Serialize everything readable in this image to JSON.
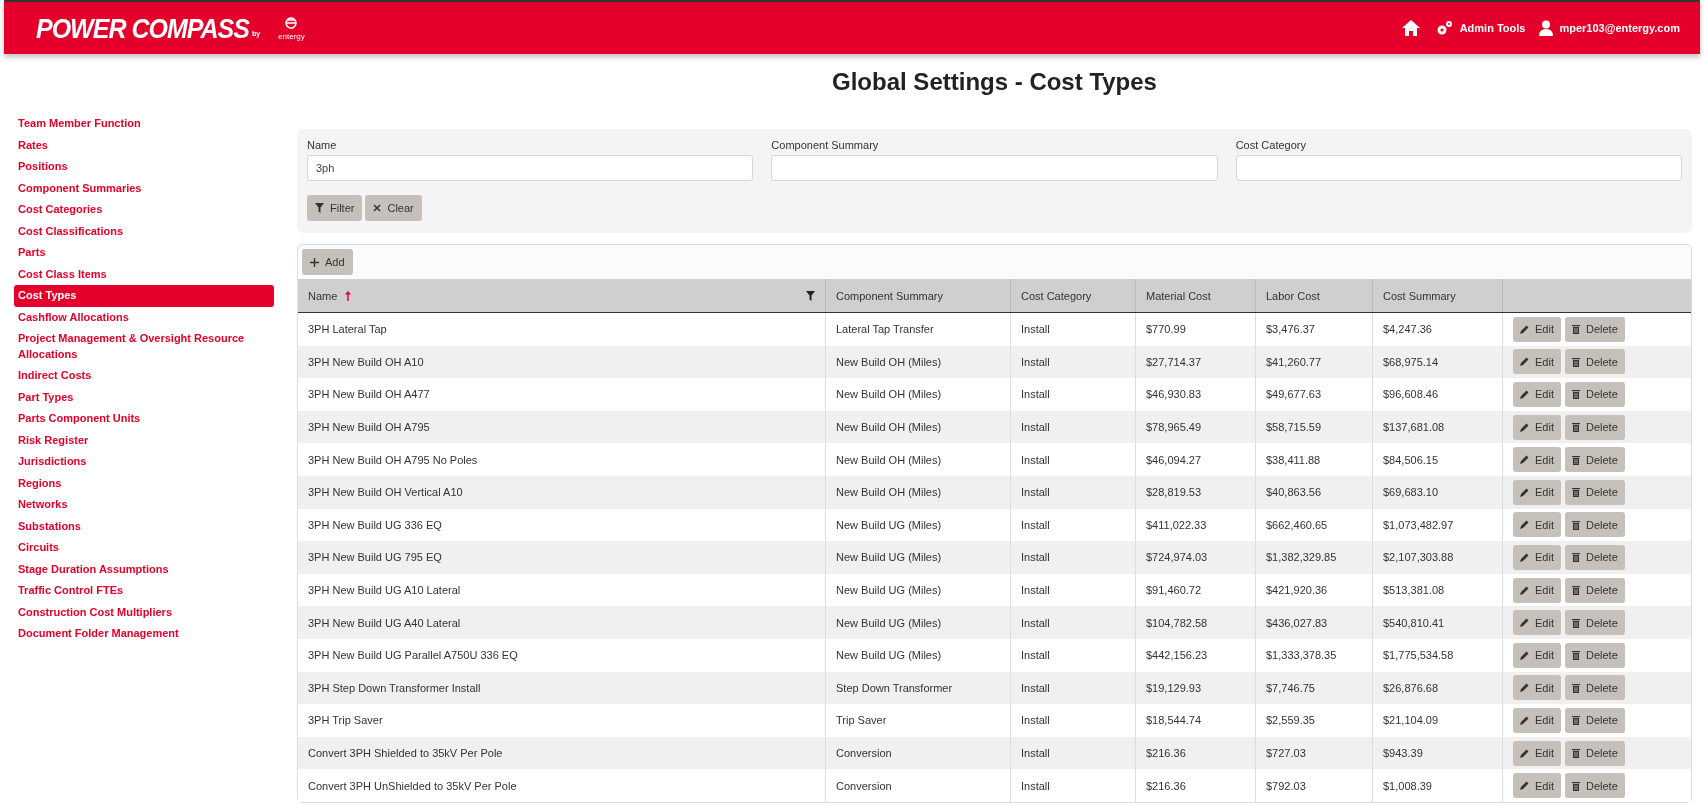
{
  "header": {
    "brand": "POWER COMPASS",
    "brand_by": "by",
    "partner": "entergy",
    "nav": [
      {
        "kind": "home"
      },
      {
        "kind": "admin",
        "label": "Admin Tools"
      },
      {
        "kind": "user",
        "label": "mper103@entergy.com"
      }
    ]
  },
  "page_title": "Global Settings - Cost Types",
  "sidebar": {
    "items": [
      {
        "label": "Team Member Function",
        "selected": false
      },
      {
        "label": "Rates",
        "selected": false
      },
      {
        "label": "Positions",
        "selected": false
      },
      {
        "label": "Component Summaries",
        "selected": false
      },
      {
        "label": "Cost Categories",
        "selected": false
      },
      {
        "label": "Cost Classifications",
        "selected": false
      },
      {
        "label": "Parts",
        "selected": false
      },
      {
        "label": "Cost Class Items",
        "selected": false
      },
      {
        "label": "Cost Types",
        "selected": true
      },
      {
        "label": "Cashflow Allocations",
        "selected": false
      },
      {
        "label": "Project Management & Oversight Resource Allocations",
        "selected": false
      },
      {
        "label": "Indirect Costs",
        "selected": false
      },
      {
        "label": "Part Types",
        "selected": false
      },
      {
        "label": "Parts Component Units",
        "selected": false
      },
      {
        "label": "Risk Register",
        "selected": false
      },
      {
        "label": "Jurisdictions",
        "selected": false
      },
      {
        "label": "Regions",
        "selected": false
      },
      {
        "label": "Networks",
        "selected": false
      },
      {
        "label": "Substations",
        "selected": false
      },
      {
        "label": "Circuits",
        "selected": false
      },
      {
        "label": "Stage Duration Assumptions",
        "selected": false
      },
      {
        "label": "Traffic Control FTEs",
        "selected": false
      },
      {
        "label": "Construction Cost Multipliers",
        "selected": false
      },
      {
        "label": "Document Folder Management",
        "selected": false
      }
    ]
  },
  "filters": {
    "fields": [
      {
        "label": "Name",
        "value": "3ph"
      },
      {
        "label": "Component Summary"
      },
      {
        "label": "Cost Category"
      }
    ],
    "buttons": [
      {
        "kind": "filter",
        "label": "Filter"
      },
      {
        "kind": "clear",
        "label": "Clear"
      }
    ]
  },
  "table": {
    "add_button": "Add",
    "columns": [
      {
        "label": "Name",
        "sorted": true,
        "filter": true
      },
      {
        "label": "Component Summary"
      },
      {
        "label": "Cost Category"
      },
      {
        "label": "Material Cost"
      },
      {
        "label": "Labor Cost"
      },
      {
        "label": "Cost Summary"
      }
    ],
    "rows": [
      {
        "cells": [
          "3PH Lateral Tap",
          "Lateral Tap Transfer",
          "Install",
          "$770.99",
          "$3,476.37",
          "$4,247.36"
        ],
        "actions": [
          "Edit",
          "Delete"
        ]
      },
      {
        "cells": [
          "3PH New Build OH A10",
          "New Build OH (Miles)",
          "Install",
          "$27,714.37",
          "$41,260.77",
          "$68,975.14"
        ],
        "actions": [
          "Edit",
          "Delete"
        ]
      },
      {
        "cells": [
          "3PH New Build OH A477",
          "New Build OH (Miles)",
          "Install",
          "$46,930.83",
          "$49,677.63",
          "$96,608.46"
        ],
        "actions": [
          "Edit",
          "Delete"
        ]
      },
      {
        "cells": [
          "3PH New Build OH A795",
          "New Build OH (Miles)",
          "Install",
          "$78,965.49",
          "$58,715.59",
          "$137,681.08"
        ],
        "actions": [
          "Edit",
          "Delete"
        ]
      },
      {
        "cells": [
          "3PH New Build OH A795 No Poles",
          "New Build OH (Miles)",
          "Install",
          "$46,094.27",
          "$38,411.88",
          "$84,506.15"
        ],
        "actions": [
          "Edit",
          "Delete"
        ]
      },
      {
        "cells": [
          "3PH New Build OH Vertical A10",
          "New Build OH (Miles)",
          "Install",
          "$28,819.53",
          "$40,863.56",
          "$69,683.10"
        ],
        "actions": [
          "Edit",
          "Delete"
        ]
      },
      {
        "cells": [
          "3PH New Build UG 336 EQ",
          "New Build UG (Miles)",
          "Install",
          "$411,022.33",
          "$662,460.65",
          "$1,073,482.97"
        ],
        "actions": [
          "Edit",
          "Delete"
        ]
      },
      {
        "cells": [
          "3PH New Build UG 795 EQ",
          "New Build UG (Miles)",
          "Install",
          "$724,974.03",
          "$1,382,329.85",
          "$2,107,303.88"
        ],
        "actions": [
          "Edit",
          "Delete"
        ]
      },
      {
        "cells": [
          "3PH New Build UG A10 Lateral",
          "New Build UG (Miles)",
          "Install",
          "$91,460.72",
          "$421,920.36",
          "$513,381.08"
        ],
        "actions": [
          "Edit",
          "Delete"
        ]
      },
      {
        "cells": [
          "3PH New Build UG A40 Lateral",
          "New Build UG (Miles)",
          "Install",
          "$104,782.58",
          "$436,027.83",
          "$540,810.41"
        ],
        "actions": [
          "Edit",
          "Delete"
        ]
      },
      {
        "cells": [
          "3PH New Build UG Parallel A750U 336 EQ",
          "New Build UG (Miles)",
          "Install",
          "$442,156.23",
          "$1,333,378.35",
          "$1,775,534.58"
        ],
        "actions": [
          "Edit",
          "Delete"
        ]
      },
      {
        "cells": [
          "3PH Step Down Transformer Install",
          "Step Down Transformer",
          "Install",
          "$19,129.93",
          "$7,746.75",
          "$26,876.68"
        ],
        "actions": [
          "Edit",
          "Delete"
        ]
      },
      {
        "cells": [
          "3PH Trip Saver",
          "Trip Saver",
          "Install",
          "$18,544.74",
          "$2,559.35",
          "$21,104.09"
        ],
        "actions": [
          "Edit",
          "Delete"
        ]
      },
      {
        "cells": [
          "Convert 3PH Shielded to 35kV Per Pole",
          "Conversion",
          "Install",
          "$216.36",
          "$727.03",
          "$943.39"
        ],
        "actions": [
          "Edit",
          "Delete"
        ]
      },
      {
        "cells": [
          "Convert 3PH UnShielded to 35kV Per Pole",
          "Conversion",
          "Install",
          "$216.36",
          "$792.03",
          "$1,008.39"
        ],
        "actions": [
          "Edit",
          "Delete"
        ]
      }
    ]
  }
}
